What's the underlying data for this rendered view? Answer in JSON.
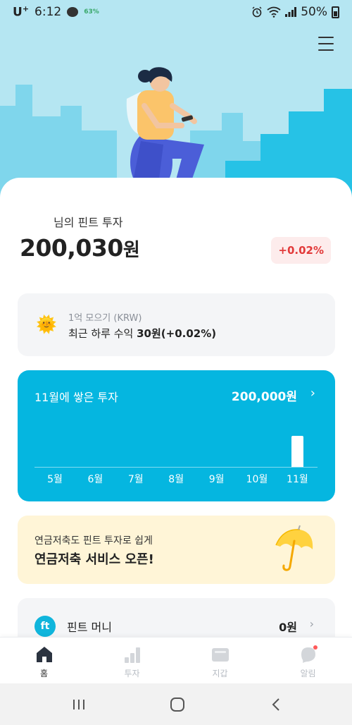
{
  "status_bar": {
    "carrier": "U",
    "carrier_sup": "+",
    "time": "6:12",
    "battery_small": "63%",
    "battery_percent": "50%"
  },
  "portfolio": {
    "owner_label": "님의 핀트 투자",
    "total_value": "200,030",
    "total_unit": "원",
    "change": "+0.02%"
  },
  "goal": {
    "title": "1억 모으기 (KRW)",
    "text_prefix": "최근 하루 수익 ",
    "text_value": "30원(+0.02%)"
  },
  "monthly": {
    "title": "11월에 쌓은 투자",
    "amount": "200,000원",
    "chevron": "›"
  },
  "chart_data": {
    "type": "bar",
    "categories": [
      "5월",
      "6월",
      "7월",
      "8월",
      "9월",
      "10월",
      "11월"
    ],
    "values": [
      0,
      0,
      0,
      0,
      0,
      0,
      200000
    ]
  },
  "promo": {
    "subtitle": "연금저축도 핀트 투자로 쉽게",
    "title": "연금저축 서비스 오픈!"
  },
  "money": {
    "icon_text": "ft",
    "label": "핀트 머니",
    "amount": "0원",
    "chevron": "›"
  },
  "tabs": [
    {
      "label": "홈",
      "icon": "home-icon",
      "active": true
    },
    {
      "label": "투자",
      "icon": "bar-chart-icon",
      "active": false
    },
    {
      "label": "지갑",
      "icon": "wallet-icon",
      "active": false
    },
    {
      "label": "알림",
      "icon": "bell-icon",
      "active": false
    }
  ],
  "colors": {
    "brand": "#05b6e0",
    "hero_bg": "#b5e6f2",
    "positive": "#e23a3a",
    "promo_bg": "#fff5d7"
  }
}
